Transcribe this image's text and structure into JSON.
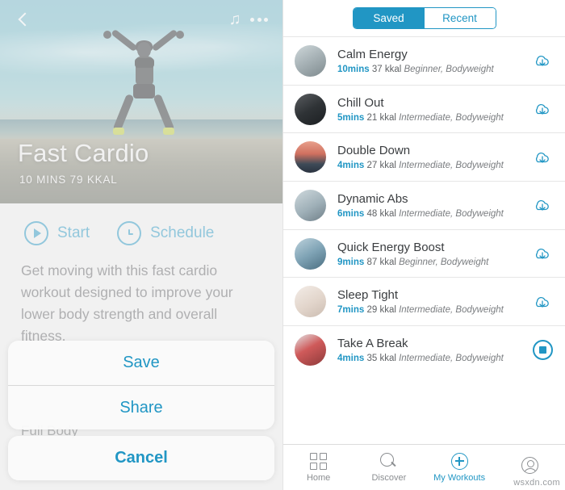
{
  "left": {
    "hero": {
      "title": "Fast Cardio",
      "subtitle": "10 MINS  79 KKAL",
      "back_icon": "back-chevron-icon",
      "music_icon": "music-note-icon",
      "more_icon": "more-dots-icon"
    },
    "actions": [
      {
        "label": "Start",
        "icon": "play-icon"
      },
      {
        "label": "Schedule",
        "icon": "clock-icon"
      }
    ],
    "description": "Get moving with this fast cardio workout designed to improve your lower body strength and overall fitness.",
    "sub_label": "Full Body",
    "action_sheet": {
      "items": [
        "Save",
        "Share"
      ],
      "cancel": "Cancel"
    },
    "accent_color": "#2196c4"
  },
  "right": {
    "segmented": {
      "options": [
        "Saved",
        "Recent"
      ],
      "selected": "Saved"
    },
    "workouts": [
      {
        "title": "Calm Energy",
        "duration": "10mins",
        "kcal": "37 kkal",
        "tags": "Beginner, Bodyweight",
        "action_icon": "download-cloud-icon"
      },
      {
        "title": "Chill Out",
        "duration": "5mins",
        "kcal": "21 kkal",
        "tags": "Intermediate, Bodyweight",
        "action_icon": "download-cloud-icon"
      },
      {
        "title": "Double Down",
        "duration": "4mins",
        "kcal": "27 kkal",
        "tags": "Intermediate, Bodyweight",
        "action_icon": "download-cloud-icon"
      },
      {
        "title": "Dynamic Abs",
        "duration": "6mins",
        "kcal": "48 kkal",
        "tags": "Intermediate, Bodyweight",
        "action_icon": "download-cloud-icon"
      },
      {
        "title": "Quick Energy Boost",
        "duration": "9mins",
        "kcal": "87 kkal",
        "tags": "Beginner, Bodyweight",
        "action_icon": "download-cloud-icon"
      },
      {
        "title": "Sleep Tight",
        "duration": "7mins",
        "kcal": "29 kkal",
        "tags": "Intermediate, Bodyweight",
        "action_icon": "download-cloud-icon"
      },
      {
        "title": "Take A Break",
        "duration": "4mins",
        "kcal": "35 kkal",
        "tags": "Intermediate, Bodyweight",
        "action_icon": "stop-circle-icon"
      }
    ],
    "tabs": [
      {
        "label": "Home",
        "icon": "grid-icon",
        "active": false
      },
      {
        "label": "Discover",
        "icon": "search-icon",
        "active": false
      },
      {
        "label": "My Workouts",
        "icon": "plus-circle-icon",
        "active": true
      },
      {
        "label": "",
        "icon": "person-icon",
        "active": false
      }
    ],
    "watermark": "wsxdn.com"
  }
}
